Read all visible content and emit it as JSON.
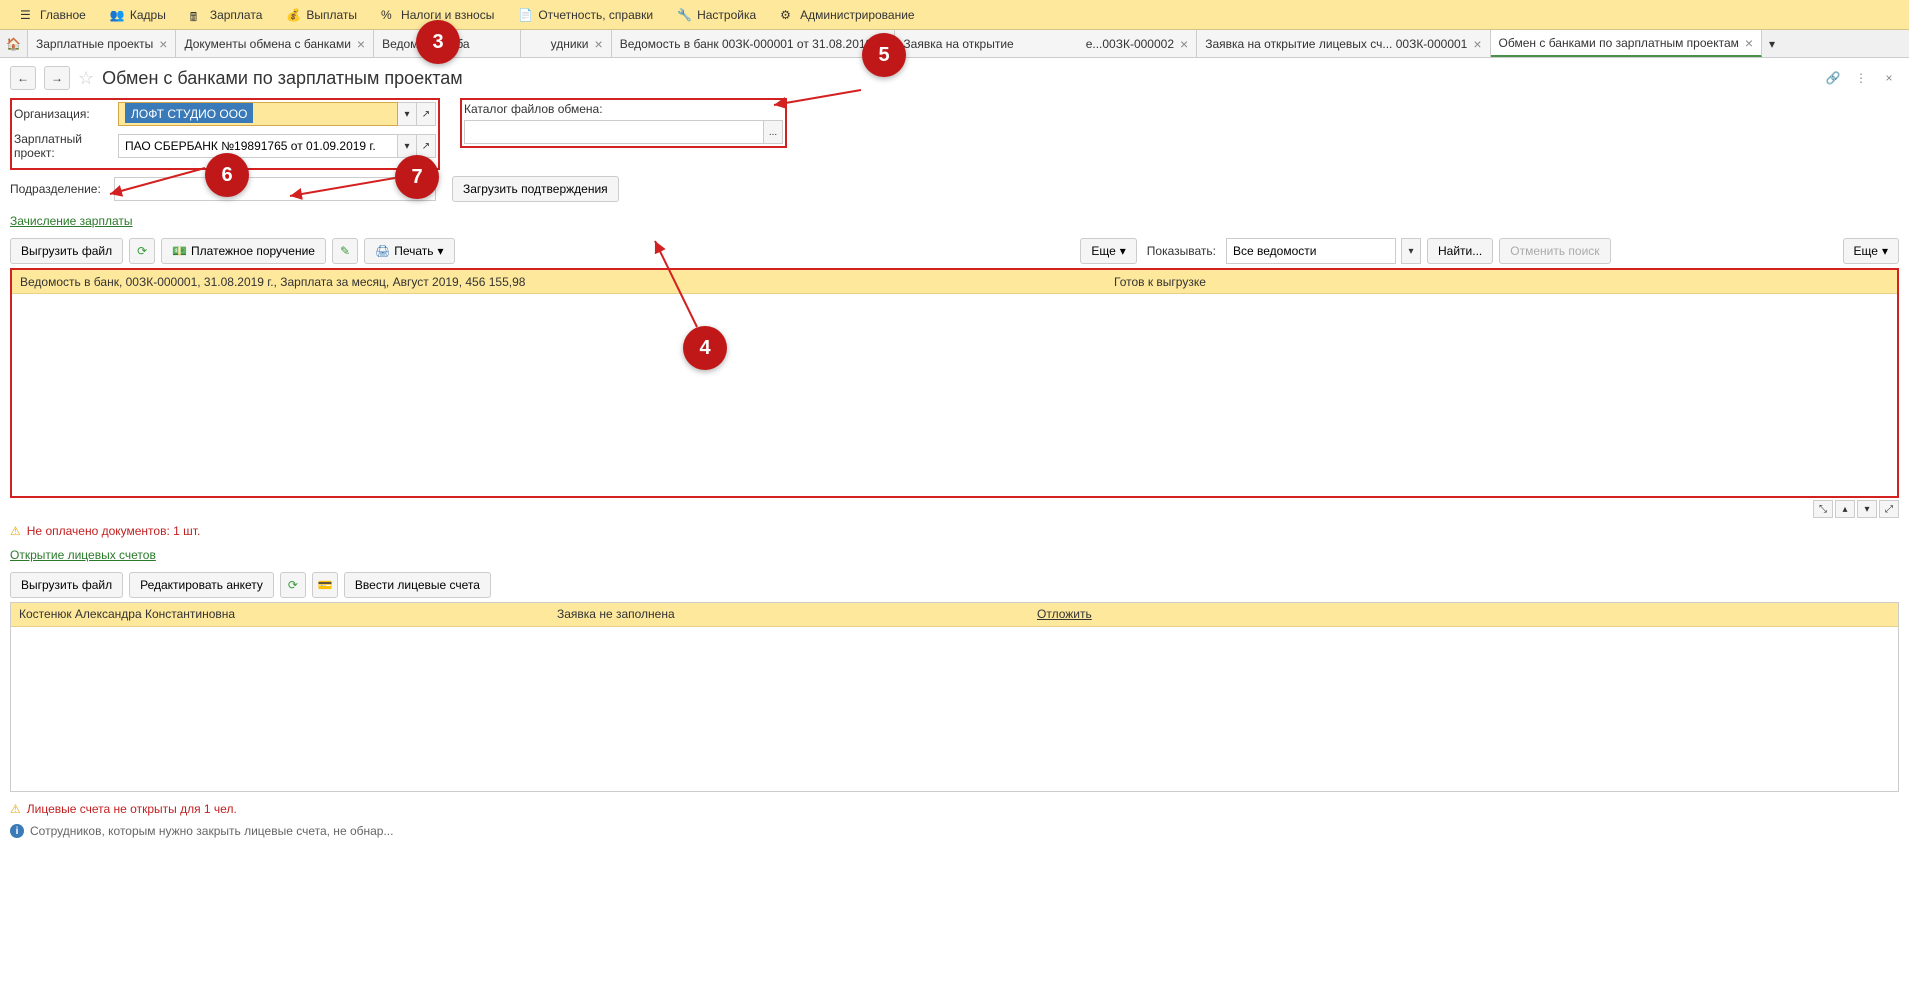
{
  "topMenu": {
    "main": "Главное",
    "personnel": "Кадры",
    "salary": "Зарплата",
    "payments": "Выплаты",
    "taxes": "Налоги и взносы",
    "reports": "Отчетность, справки",
    "settings": "Настройка",
    "admin": "Администрирование"
  },
  "tabs": {
    "t1": "Зарплатные проекты",
    "t2": "Документы обмена с банками",
    "t3": "Ведомости в ба",
    "t4": "удники",
    "t5": "Ведомость в банк 00ЗК-000001 от 31.08.2019",
    "t6": "Заявка на открытие",
    "t6b": "е...00ЗК-000002",
    "t7": "Заявка на открытие лицевых сч... 00ЗК-000001",
    "t8": "Обмен с банками по зарплатным проектам"
  },
  "pageTitle": "Обмен с банками по зарплатным проектам",
  "form": {
    "orgLabel": "Организация:",
    "orgValue": "ЛОФТ СТУДИО ООО",
    "projectLabel": "Зарплатный проект:",
    "projectValue": "ПАО СБЕРБАНК №19891765 от 01.09.2019 г.",
    "divisionLabel": "Подразделение:",
    "divisionValue": "",
    "catalogLabel": "Каталог файлов обмена:",
    "catalogValue": "",
    "loadConfirmBtn": "Загрузить подтверждения"
  },
  "linkSalary": "Зачисление зарплаты",
  "toolbar1": {
    "exportFile": "Выгрузить файл",
    "paymentOrder": "Платежное поручение",
    "print": "Печать",
    "more": "Еще",
    "showLabel": "Показывать:",
    "showValue": "Все ведомости",
    "find": "Найти...",
    "cancelSearch": "Отменить поиск",
    "more2": "Еще"
  },
  "tableRow1": {
    "c1": "Ведомость в банк, 00ЗК-000001, 31.08.2019 г., Зарплата за месяц, Август 2019, 456 155,98",
    "c2": "Готов к выгрузке"
  },
  "warning1": "Не оплачено документов: 1 шт.",
  "linkAccounts": "Открытие лицевых счетов",
  "toolbar2": {
    "exportFile": "Выгрузить файл",
    "editForm": "Редактировать анкету",
    "enterAccounts": "Ввести лицевые счета"
  },
  "table2Row": {
    "c1": "Костенюк Александра Константиновна",
    "c2": "Заявка не заполнена",
    "c3": "Отложить"
  },
  "warning2": "Лицевые счета не открыты для 1 чел.",
  "info1": "Сотрудников, которым нужно закрыть лицевые счета, не обнар...",
  "markers": {
    "m3": "3",
    "m4": "4",
    "m5": "5",
    "m6": "6",
    "m7": "7"
  }
}
